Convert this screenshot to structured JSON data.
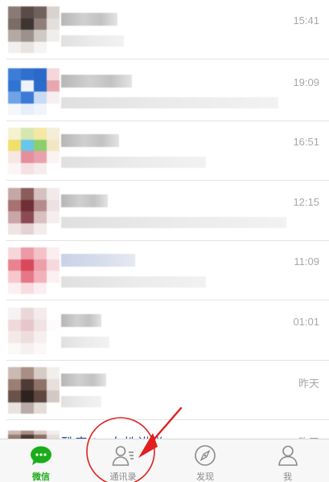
{
  "chats": [
    {
      "time": "15:41",
      "avatar_colors": [
        "#8a7a76",
        "#5b4b46",
        "#6f625d",
        "#d9d3d0",
        "#7b6c67",
        "#3e3431",
        "#8e7f79",
        "#e3dfdd",
        "#b3aaa6",
        "#9d918c",
        "#cfc9c6",
        "#f0eeed",
        "#f2f0ef",
        "#e6e3e1",
        "#f5f4f3",
        "#ffffff"
      ]
    },
    {
      "time": "19:09",
      "avatar_colors": [
        "#3c7dd8",
        "#2f6fcd",
        "#2a69c9",
        "#f4d7da",
        "#2f74d3",
        "#eef3fb",
        "#2b6bcb",
        "#e8a7b0",
        "#6fa3e6",
        "#3b7ad6",
        "#c9daf4",
        "#f6eef0",
        "#f4f7fc",
        "#e7eef9",
        "#f0f4fb",
        "#ffffff"
      ]
    },
    {
      "time": "16:51",
      "avatar_colors": [
        "#f6f1cf",
        "#d6e7b1",
        "#f3e9a4",
        "#f4eed8",
        "#f0df6b",
        "#6ac6e8",
        "#8ccf6d",
        "#f3e6c3",
        "#f7e7e4",
        "#e58e9c",
        "#e9a2ad",
        "#faf3f1",
        "#fbf6f5",
        "#f4e1e3",
        "#f7ecec",
        "#ffffff"
      ]
    },
    {
      "time": "12:15",
      "avatar_colors": [
        "#c3a8a6",
        "#8a5c5a",
        "#d5c1bf",
        "#f2eaea",
        "#a87172",
        "#6f2f36",
        "#b58c8d",
        "#ede1e1",
        "#c9a6a7",
        "#8c4a53",
        "#d9bfc0",
        "#f6eeee",
        "#efe3e3",
        "#e5d2d3",
        "#f4ebeb",
        "#ffffff"
      ]
    },
    {
      "time": "11:09",
      "avatar_colors": [
        "#f6d6da",
        "#ec9aa5",
        "#f3c2c9",
        "#fbeef0",
        "#e9838f",
        "#d8485c",
        "#ee9eaa",
        "#f6d9dd",
        "#f5c8ce",
        "#e57786",
        "#f1b2bb",
        "#fbeff1",
        "#fceff1",
        "#f6dce0",
        "#fbeef0",
        "#ffffff"
      ]
    },
    {
      "time": "01:01",
      "avatar_colors": [
        "#f7f2f2",
        "#ead8d8",
        "#f4ecec",
        "#ffffff",
        "#efd9da",
        "#e6c6c8",
        "#f1e2e3",
        "#fdfbfb",
        "#f4e9e9",
        "#eedddd",
        "#f7efef",
        "#ffffff",
        "#fbf8f8",
        "#f6f0f0",
        "#fbf8f8",
        "#ffffff"
      ]
    },
    {
      "time": "昨天",
      "avatar_colors": [
        "#cbbab3",
        "#a88e84",
        "#d7cbc6",
        "#f2eeec",
        "#9b7f74",
        "#4f3b35",
        "#8e7268",
        "#e6dfdc",
        "#6a524a",
        "#2e221e",
        "#5d4740",
        "#d2c8c4",
        "#e9e3e0",
        "#b9aba5",
        "#e4dcd8",
        "#ffffff"
      ]
    }
  ],
  "partial_row": {
    "name_visible": "酷音 |   女性讲堂",
    "time": "昨天"
  },
  "tabs": [
    {
      "label": "微信",
      "icon": "chat-bubble-icon",
      "active": true
    },
    {
      "label": "通讯录",
      "icon": "contacts-icon",
      "active": false
    },
    {
      "label": "发现",
      "icon": "compass-icon",
      "active": false
    },
    {
      "label": "我",
      "icon": "person-icon",
      "active": false
    }
  ],
  "colors": {
    "accent": "#1aad19",
    "annotation": "#e02020",
    "tab_inactive": "#8a8a8a",
    "time_text": "#a8a8a8"
  }
}
